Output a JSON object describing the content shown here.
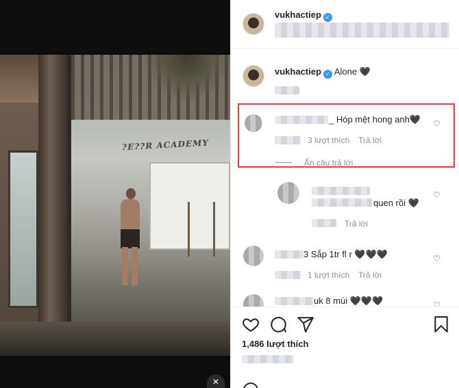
{
  "post": {
    "username": "vukhactiep",
    "caption": "Alone 🖤",
    "likes_count": "1,486 lượt thích"
  },
  "comments": [
    {
      "text": "_ Hóp mệt hong anh🖤",
      "likes": "3 lượt thích",
      "reply": "Trả lời",
      "hide_replies": "Ẩn câu trả lời"
    },
    {
      "text": "quen rồi 🖤",
      "reply": "Trả lời"
    },
    {
      "text": "3 Sắp 1tr fl r 🖤🖤🖤",
      "likes": "1 lượt thích",
      "reply": "Trả lời"
    },
    {
      "text": "uk 8 múi 🖤🖤🖤"
    }
  ],
  "media": {
    "sign_text": "?E??R ACADEMY",
    "sound_icon": "mute-icon"
  },
  "icons": {
    "like": "heart-icon",
    "comment": "comment-icon",
    "share": "share-icon",
    "save": "bookmark-icon",
    "verified": "verified-badge-icon"
  },
  "colors": {
    "highlight": "#e63939",
    "verified": "#3897f0",
    "text": "#262626",
    "muted": "#8e8e8e"
  }
}
